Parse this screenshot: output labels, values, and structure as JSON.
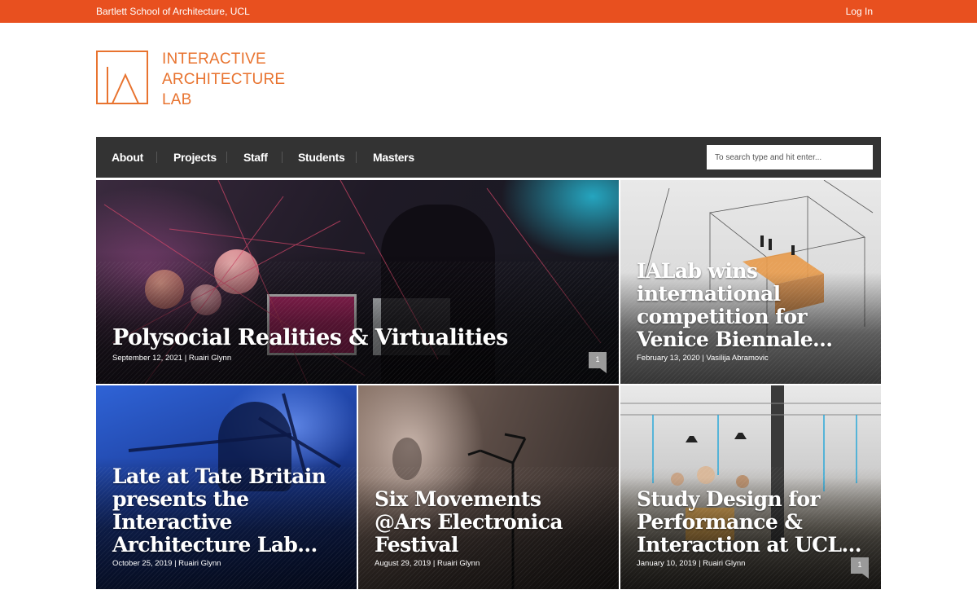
{
  "topbar": {
    "site_name": "Bartlett School of Architecture, UCL",
    "login_label": "Log In"
  },
  "logo": {
    "lines": [
      "INTERACTIVE",
      "ARCHITECTURE",
      "LAB"
    ]
  },
  "nav": {
    "items": [
      "About",
      "Projects",
      "Staff",
      "Students",
      "Masters"
    ],
    "search_placeholder": "To search type and hit enter..."
  },
  "posts": [
    {
      "title": "Polysocial Realities & Virtualities",
      "date": "September 12, 2021",
      "author": "Ruairi Glynn",
      "comments": "1"
    },
    {
      "title": "IALab wins international competition for Venice Biennale…",
      "date": "February 13, 2020",
      "author": "Vasilija Abramovic"
    },
    {
      "title": "Late at Tate Britain presents the Interactive Architecture Lab…",
      "date": "October 25, 2019",
      "author": "Ruairi Glynn"
    },
    {
      "title": "Six Movements @Ars Electronica Festival",
      "date": "August 29, 2019",
      "author": "Ruairi Glynn"
    },
    {
      "title": "Study Design for Performance & Interaction at UCL…",
      "date": "January 10, 2019",
      "author": "Ruairi Glynn",
      "comments": "1"
    }
  ],
  "colors": {
    "brand": "#e8501f",
    "logo": "#e8732f",
    "nav_bg": "#333333"
  },
  "icons": [
    "logo-mark-icon",
    "comment-bubble-icon"
  ]
}
